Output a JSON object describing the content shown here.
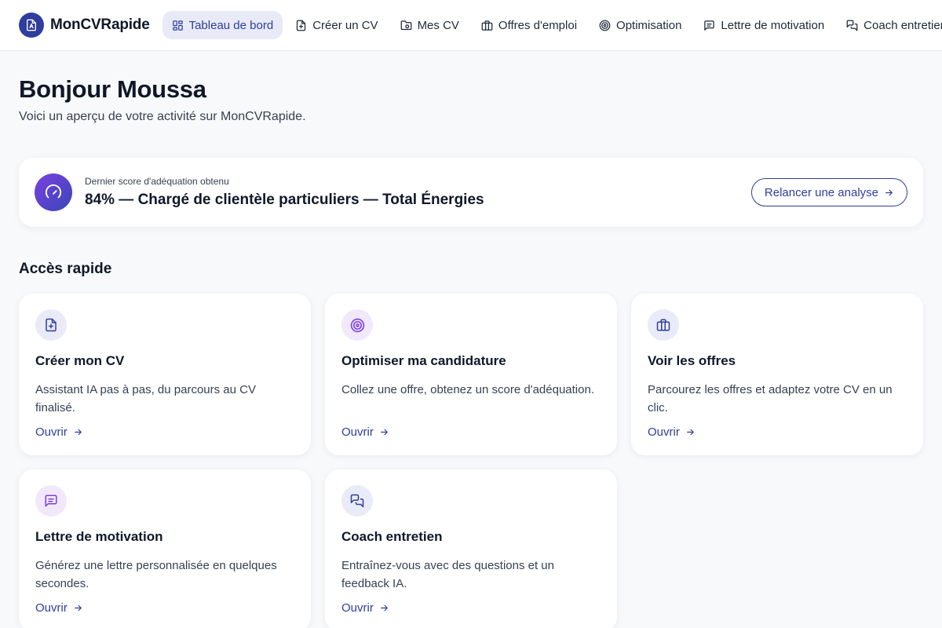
{
  "app": {
    "name": "MonCVRapide"
  },
  "colors": {
    "accent": "#2f3d9e",
    "purple": "#7b3fe0",
    "background": "#f8f9fb"
  },
  "nav": {
    "items": [
      {
        "label": "Tableau de bord",
        "icon": "dashboard-icon",
        "active": true
      },
      {
        "label": "Créer un CV",
        "icon": "file-plus-icon"
      },
      {
        "label": "Mes CV",
        "icon": "folder-icon"
      },
      {
        "label": "Offres d'emploi",
        "icon": "briefcase-icon"
      },
      {
        "label": "Optimisation",
        "icon": "target-icon"
      },
      {
        "label": "Lettre de motivation",
        "icon": "message-icon"
      },
      {
        "label": "Coach entretien",
        "icon": "chat-icon"
      }
    ]
  },
  "header": {
    "greeting": "Bonjour Moussa",
    "subtitle": "Voici un aperçu de votre activité sur MonCVRapide."
  },
  "score": {
    "icon": "gauge-icon",
    "label": "Dernier score d'adéquation obtenu",
    "value": "84% — Chargé de clientèle particuliers — Total Énergies",
    "button": "Relancer une analyse"
  },
  "quick_access": {
    "title": "Accès rapide",
    "link_label": "Ouvrir",
    "cards": [
      {
        "title": "Créer mon CV",
        "desc": "Assistant IA pas à pas, du parcours au CV finalisé.",
        "icon": "file-plus-icon"
      },
      {
        "title": "Optimiser ma candidature",
        "desc": "Collez une offre, obtenez un score d'adéquation.",
        "icon": "target-icon"
      },
      {
        "title": "Voir les offres",
        "desc": "Parcourez les offres et adaptez votre CV en un clic.",
        "icon": "briefcase-icon"
      },
      {
        "title": "Lettre de motivation",
        "desc": "Générez une lettre personnalisée en quelques secondes.",
        "icon": "message-icon"
      },
      {
        "title": "Coach entretien",
        "desc": "Entraînez-vous avec des questions et un feedback IA.",
        "icon": "chat-icon"
      }
    ]
  }
}
